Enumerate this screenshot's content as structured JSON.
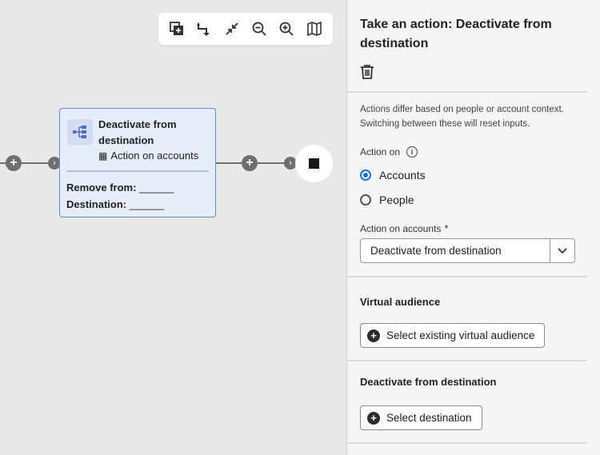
{
  "toolbar": {
    "icons": [
      "duplicate-icon",
      "undo-icon",
      "collapse-icon",
      "zoom-out-icon",
      "zoom-in-icon",
      "map-icon"
    ]
  },
  "canvas": {
    "connector_plus_glyph": "+",
    "connector_arrow_glyph": "›",
    "node": {
      "title": "Deactivate from destination",
      "subtitle": "Action on accounts",
      "subtitle_icon_glyph": "▦",
      "remove_from_label": "Remove from:",
      "remove_from_value": "______",
      "destination_label": "Destination:",
      "destination_value": "______"
    }
  },
  "panel": {
    "title": "Take an action: Deactivate from destination",
    "help_text": "Actions differ based on people or account context. Switching between these will reset inputs.",
    "action_on_label": "Action on",
    "info_glyph": "i",
    "radio_options": [
      {
        "label": "Accounts",
        "selected": true
      },
      {
        "label": "People",
        "selected": false
      }
    ],
    "action_on_accounts_label": "Action on accounts",
    "required_marker": "*",
    "select_value": "Deactivate from destination",
    "virtual_audience_title": "Virtual audience",
    "virtual_audience_button": "Select existing virtual audience",
    "deactivate_section_title": "Deactivate from destination",
    "select_destination_button": "Select destination",
    "plus_glyph": "+"
  },
  "colors": {
    "accent": "#1473e6",
    "node_bg": "#e6eefa",
    "node_border": "#5b8fe0"
  }
}
